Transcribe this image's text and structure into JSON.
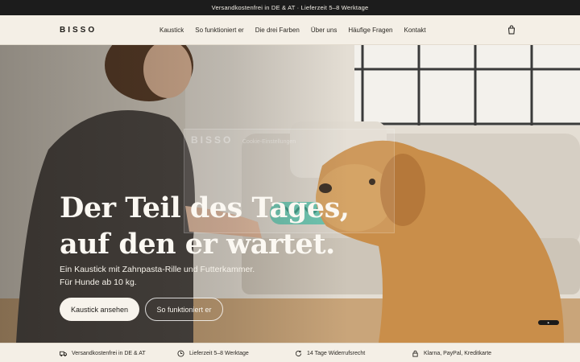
{
  "announcement": "Versandkostenfrei in DE & AT · Lieferzeit 5–8 Werktage",
  "header": {
    "logo": "BISSO",
    "nav": [
      "Kaustick",
      "So funktioniert er",
      "Die drei Farben",
      "Über uns",
      "Häufige Fragen",
      "Kontakt"
    ],
    "cart_icon": "shopping-bag-icon"
  },
  "hero": {
    "headline_line1": "Der Teil des Tages,",
    "headline_line2": "auf den er wartet.",
    "sub_line1": "Ein Kaustick mit Zahnpasta-Rille und Futterkammer.",
    "sub_line2": "Für Hunde ab 10 kg.",
    "primary_button": "Kaustick ansehen",
    "secondary_button": "So funktioniert er",
    "ghost_overlay_logo": "BISSO",
    "ghost_overlay_title": "Cookie-Einstellungen"
  },
  "trust_bar": [
    {
      "icon": "truck-icon",
      "label": "Versandkostenfrei in DE & AT"
    },
    {
      "icon": "clock-icon",
      "label": "Lieferzeit 5–8 Werktage"
    },
    {
      "icon": "return-icon",
      "label": "14 Tage Widerrufsrecht"
    },
    {
      "icon": "lock-icon",
      "label": "Klarna, PayPal, Kreditkarte"
    }
  ],
  "colors": {
    "announcement_bg": "#1c1c1c",
    "page_bg": "#f4efe6",
    "toy_accent": "#5fbfa8",
    "dog_fur": "#c98e4a"
  }
}
